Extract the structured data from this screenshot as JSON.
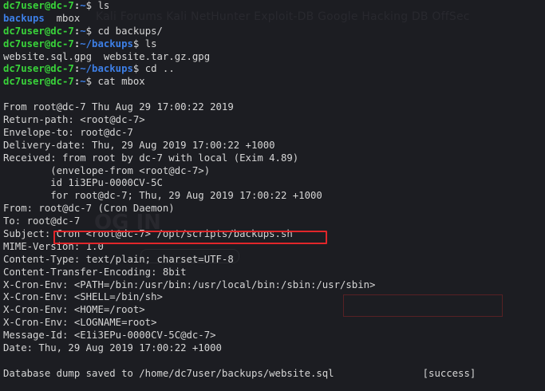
{
  "prompt": {
    "user_host": "dc7user@dc-7",
    "home": "~",
    "backups_dir": "~/backups",
    "sign": "$"
  },
  "colors": {
    "background": "#1c1d22",
    "prompt_user": "#39d43a",
    "path_and_dirs": "#3d7fe6",
    "text": "#d6d6d6",
    "highlight_box": "#e0262a"
  },
  "session": [
    {
      "cmd": "ls",
      "output_dir": "backups",
      "output_file": "mbox"
    },
    {
      "cmd": "cd backups/"
    },
    {
      "cmd": "ls",
      "output": "website.sql.gpg  website.tar.gz.gpg"
    },
    {
      "cmd": "cd .."
    },
    {
      "cmd": "cat mbox"
    }
  ],
  "mbox": {
    "lines": [
      "",
      "From root@dc-7 Thu Aug 29 17:00:22 2019",
      "Return-path: <root@dc-7>",
      "Envelope-to: root@dc-7",
      "Delivery-date: Thu, 29 Aug 2019 17:00:22 +1000",
      "Received: from root by dc-7 with local (Exim 4.89)",
      "        (envelope-from <root@dc-7>)",
      "        id 1i3EPu-0000CV-5C",
      "        for root@dc-7; Thu, 29 Aug 2019 17:00:22 +1000",
      "From: root@dc-7 (Cron Daemon)",
      "To: root@dc-7",
      "Subject: Cron <root@dc-7> /opt/scripts/backups.sh",
      "MIME-Version: 1.0",
      "Content-Type: text/plain; charset=UTF-8",
      "Content-Transfer-Encoding: 8bit",
      "X-Cron-Env: <PATH=/bin:/usr/bin:/usr/local/bin:/sbin:/usr/sbin>",
      "X-Cron-Env: <SHELL=/bin/sh>",
      "X-Cron-Env: <HOME=/root>",
      "X-Cron-Env: <LOGNAME=root>",
      "Message-Id: <E1i3EPu-0000CV-5C@dc-7>",
      "Date: Thu, 29 Aug 2019 17:00:22 +1000",
      "",
      "Database dump saved to /home/dc7user/backups/website.sql               [success]"
    ]
  },
  "background_window": {
    "bookmarks": "Kali Forums   Kali NetHunter   Exploit-DB   Google Hacking DB   OffSec",
    "heading": "OG IN"
  }
}
